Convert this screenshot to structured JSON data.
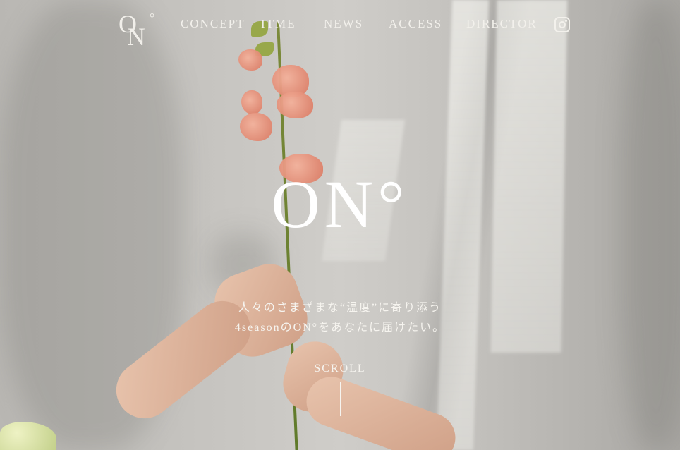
{
  "brand": {
    "logo_o": "O",
    "logo_n": "N",
    "logo_deg": "°"
  },
  "nav": {
    "items": [
      {
        "label": "CONCEPT"
      },
      {
        "label": "ITME"
      },
      {
        "label": "NEWS"
      },
      {
        "label": "ACCESS"
      },
      {
        "label": "DIRECTOR"
      }
    ],
    "social_icon": "instagram-icon"
  },
  "hero": {
    "title": "ON°",
    "tagline_line1": "人々のさまざまな“温度”に寄り添う",
    "tagline_line2": "4seasonのON°をあなたに届けたい。",
    "scroll_label": "SCROLL"
  },
  "colors": {
    "text": "#f3f1ec",
    "wall": "#c9c7c3",
    "petal": "#e08a72",
    "stem": "#6f8432"
  }
}
